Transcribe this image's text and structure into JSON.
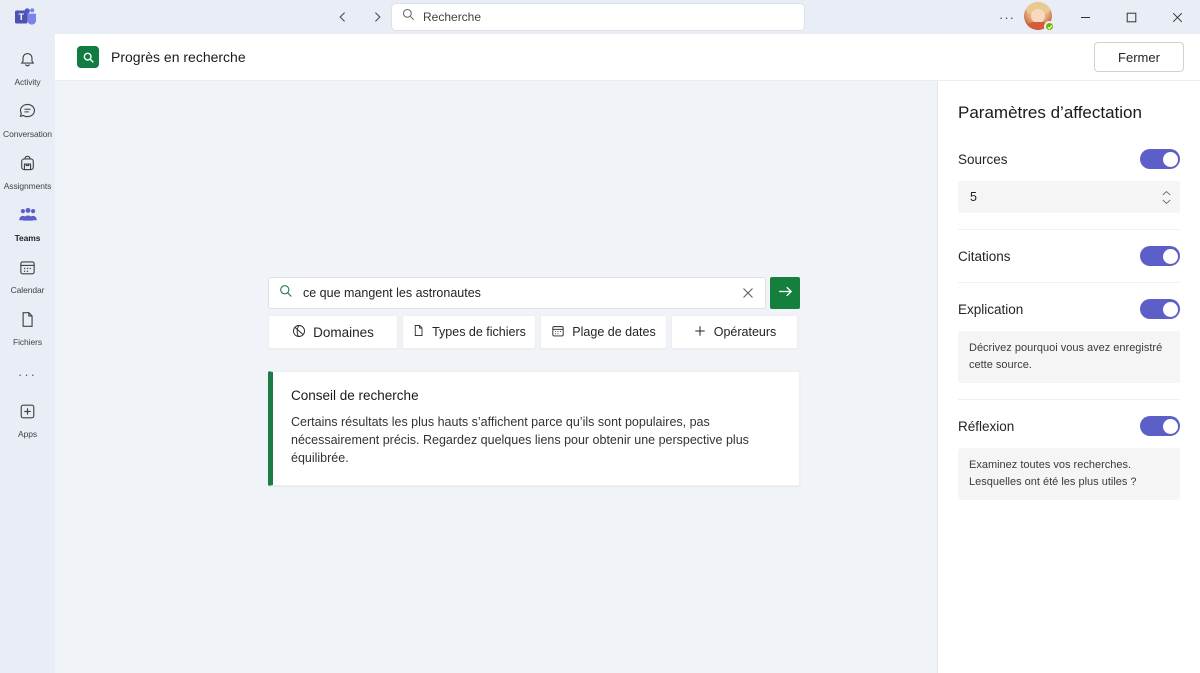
{
  "titlebar": {
    "logo_icon": "teams-logo-icon",
    "back_icon": "chevron-left-icon",
    "forward_icon": "chevron-right-icon",
    "search_icon": "search-icon",
    "search_placeholder": "Recherche",
    "search_value": "",
    "more_label": "···",
    "minimize_label": "─",
    "maximize_label": "□",
    "close_label": "✕",
    "presence": "available"
  },
  "rail": {
    "items": [
      {
        "label": "Activity",
        "icon": "bell-icon",
        "active": false
      },
      {
        "label": "Conversation",
        "icon": "chat-icon",
        "active": false
      },
      {
        "label": "Assignments",
        "icon": "backpack-icon",
        "active": false
      },
      {
        "label": "Teams",
        "icon": "people-icon",
        "active": true
      },
      {
        "label": "Calendar",
        "icon": "calendar-icon",
        "active": false
      },
      {
        "label": "Fichiers",
        "icon": "file-icon",
        "active": false
      }
    ],
    "more_label": "···",
    "apps": {
      "label": "Apps",
      "icon": "plus-box-icon"
    }
  },
  "apphead": {
    "icon": "research-search-icon",
    "title": "Progrès en recherche",
    "close_label": "Fermer"
  },
  "workspace": {
    "search": {
      "icon": "search-icon",
      "value": "ce que mangent les astronautes",
      "clear_icon": "close-icon",
      "submit_icon": "arrow-right-icon"
    },
    "chips": [
      {
        "label": "Domaines",
        "icon": "globe-icon"
      },
      {
        "label": "Types de fichiers",
        "icon": "document-icon"
      },
      {
        "label": "Plage de dates",
        "icon": "calendar-icon"
      },
      {
        "label": "Opérateurs",
        "icon": "plus-icon"
      }
    ],
    "tip": {
      "title": "Conseil de recherche",
      "body": "Certains résultats les plus hauts s’affichent parce qu’ils sont populaires, pas nécessairement précis. Regardez quelques liens pour obtenir une perspective plus équilibrée."
    }
  },
  "panel": {
    "title": "Paramètres d’affectation",
    "sources": {
      "label": "Sources",
      "enabled": true,
      "value": "5",
      "up_icon": "chevron-up-icon",
      "down_icon": "chevron-down-icon"
    },
    "citations": {
      "label": "Citations",
      "enabled": true
    },
    "explication": {
      "label": "Explication",
      "enabled": true,
      "hint": "Décrivez pourquoi vous avez enregistré cette source."
    },
    "reflexion": {
      "label": "Réflexion",
      "enabled": true,
      "hint": "Examinez toutes vos recherches. Lesquelles ont été les plus utiles ?"
    }
  },
  "colors": {
    "accent_purple": "#5B5FC7",
    "accent_green": "#15803D",
    "tip_bar_green": "#1E7B45",
    "presence_green": "#6BB700",
    "workspace_bg": "#F0F4F8",
    "chrome_bg": "#E9EEF6"
  }
}
